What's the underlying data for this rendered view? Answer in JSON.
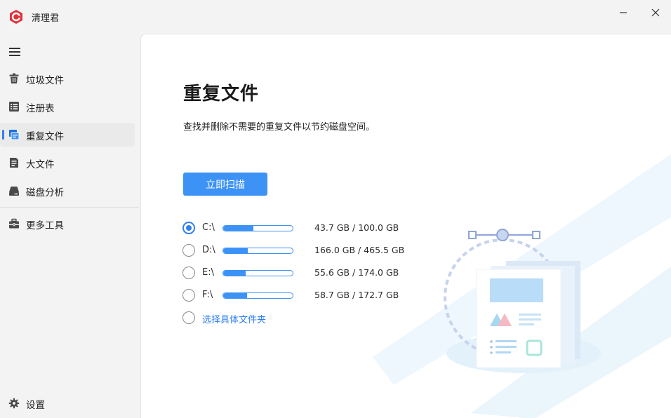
{
  "app": {
    "title": "清理君"
  },
  "sidebar": {
    "items": [
      {
        "label": "垃圾文件"
      },
      {
        "label": "注册表"
      },
      {
        "label": "重复文件"
      },
      {
        "label": "大文件"
      },
      {
        "label": "磁盘分析"
      },
      {
        "label": "更多工具"
      }
    ],
    "settings_label": "设置",
    "active_index": 2
  },
  "main": {
    "title": "重复文件",
    "description": "查找并删除不需要的重复文件以节约磁盘空间。",
    "scan_button": "立即扫描",
    "drives": [
      {
        "name": "C:\\",
        "size": "43.7 GB / 100.0 GB",
        "used_fraction": 0.437,
        "selected": true
      },
      {
        "name": "D:\\",
        "size": "166.0 GB / 465.5 GB",
        "used_fraction": 0.357,
        "selected": false
      },
      {
        "name": "E:\\",
        "size": "55.6 GB / 174.0 GB",
        "used_fraction": 0.32,
        "selected": false
      },
      {
        "name": "F:\\",
        "size": "58.7 GB / 172.7 GB",
        "used_fraction": 0.34,
        "selected": false
      }
    ],
    "folder_option": "选择具体文件夹"
  },
  "colors": {
    "accent": "#3d92f5",
    "active_indicator": "#2f7ff3",
    "logo": "#e0313a"
  }
}
